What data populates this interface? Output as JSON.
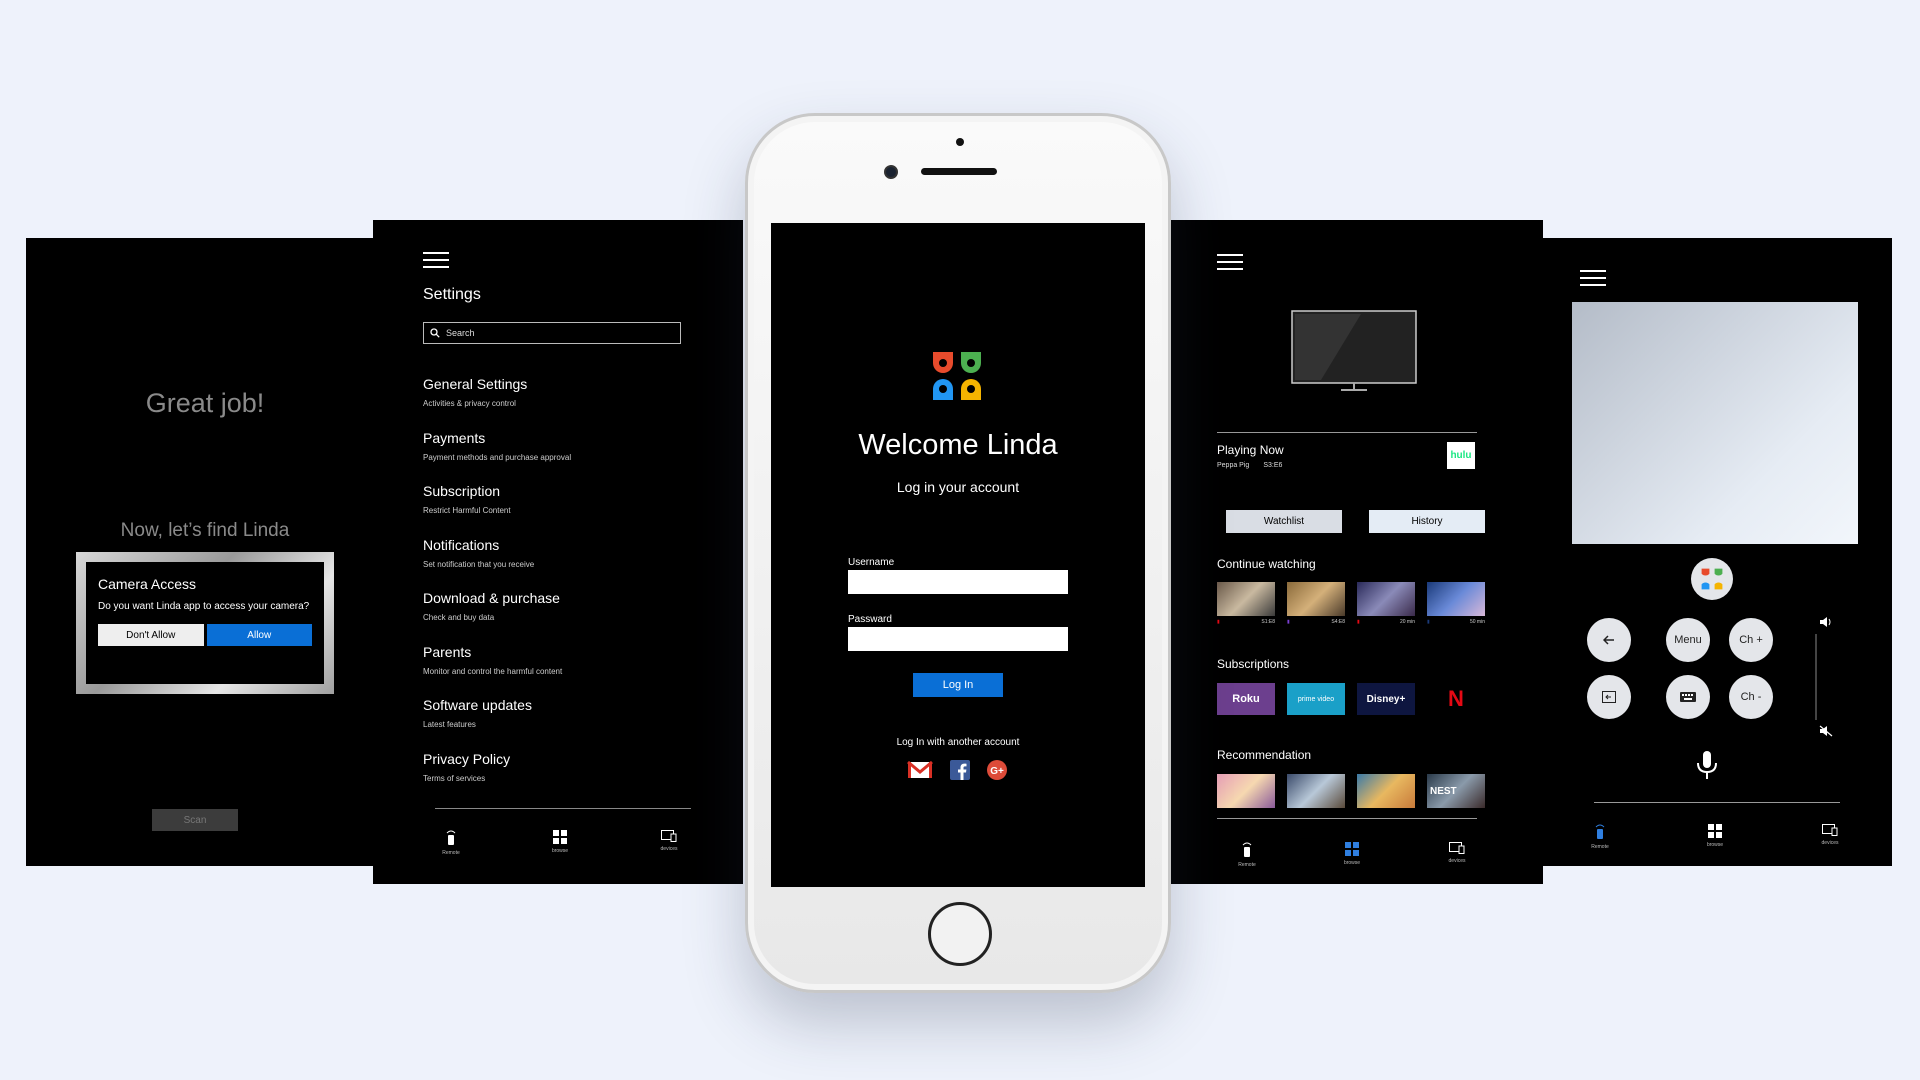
{
  "camera_screen": {
    "heading": "Great job!",
    "subheading": "Now, let’s find Linda",
    "dialog": {
      "title": "Camera Access",
      "message": "Do you want Linda app to access your camera?",
      "deny_label": "Don't Allow",
      "allow_label": "Allow"
    },
    "scan_label": "Scan"
  },
  "settings_screen": {
    "title": "Settings",
    "search_placeholder": "Search",
    "items": [
      {
        "title": "General Settings",
        "subtitle": "Activities & privacy control"
      },
      {
        "title": "Payments",
        "subtitle": "Payment methods and purchase approval"
      },
      {
        "title": "Subscription",
        "subtitle": "Restrict Harmful Content"
      },
      {
        "title": "Notifications",
        "subtitle": "Set notification that you receive"
      },
      {
        "title": "Download & purchase",
        "subtitle": "Check and buy data"
      },
      {
        "title": "Parents",
        "subtitle": "Monitor and control the harmful content"
      },
      {
        "title": "Software updates",
        "subtitle": "Latest features"
      },
      {
        "title": "Privacy Policy",
        "subtitle": "Terms of services"
      }
    ],
    "nav": {
      "remote": "Remote",
      "browse": "browse",
      "devices": "devices"
    }
  },
  "login_screen": {
    "welcome": "Welcome Linda",
    "subtitle": "Log in your account",
    "username_label": "Username",
    "password_label": "Passward",
    "login_button": "Log In",
    "another_account": "Log In with another account",
    "social": [
      "gmail-icon",
      "facebook-icon",
      "google-plus-icon"
    ]
  },
  "browse_screen": {
    "playing_now": "Playing Now",
    "show": "Peppa Pig",
    "episode": "S3:E6",
    "provider": "hulu",
    "watchlist": "Watchlist",
    "history": "History",
    "continue_watching": "Continue watching",
    "continue_items": [
      {
        "meta": "S1:E8"
      },
      {
        "meta": "S4:E8"
      },
      {
        "meta": "20 min"
      },
      {
        "meta": "50 min"
      }
    ],
    "subscriptions_label": "Subscriptions",
    "subscriptions": [
      "Roku",
      "prime video",
      "Disney+",
      "N"
    ],
    "recommendation_label": "Recommendation",
    "recommendation_text": "NEST",
    "nav": {
      "remote": "Remote",
      "browse": "browse",
      "devices": "devices"
    }
  },
  "remote_screen": {
    "menu": "Menu",
    "ch_up": "Ch +",
    "ch_down": "Ch -",
    "nav": {
      "remote": "Remote",
      "browse": "browse",
      "devices": "devices"
    }
  },
  "colors": {
    "accent_blue": "#0a6fd6",
    "background": "#eef2fb",
    "screen_bg": "#000000"
  }
}
